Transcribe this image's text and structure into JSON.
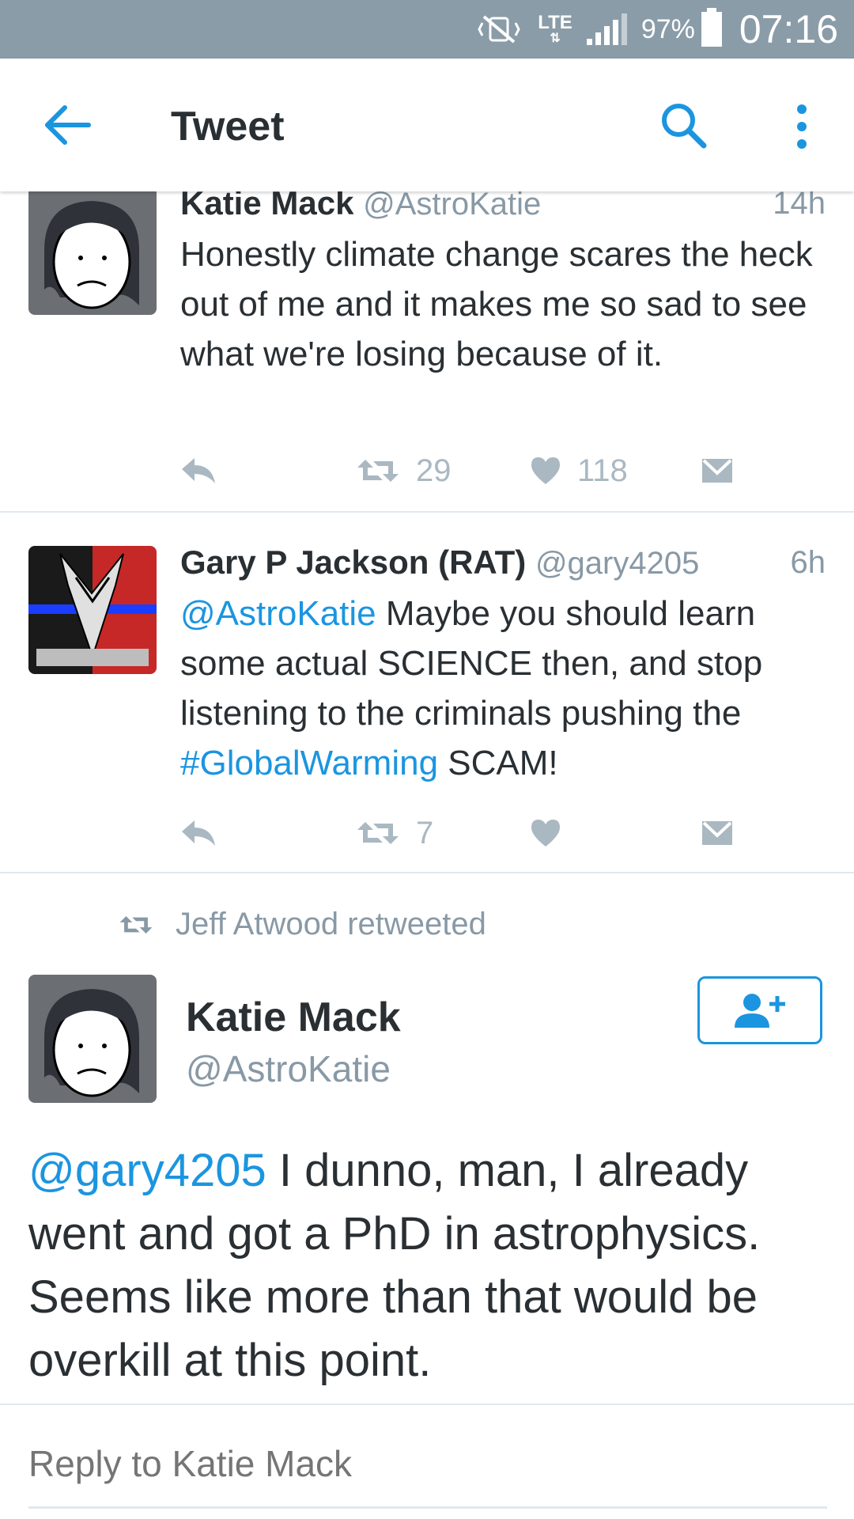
{
  "status_bar": {
    "network": "LTE",
    "battery": "97%",
    "time": "07:16"
  },
  "app_bar": {
    "title": "Tweet"
  },
  "tweets": [
    {
      "name": "Katie Mack",
      "handle": "@AstroKatie",
      "time": "14h",
      "text": "Honestly climate change scares the heck out of me and it makes me so sad to see what we're losing because of it.",
      "retweets": "29",
      "likes": "118"
    },
    {
      "name": "Gary P Jackson (RAT)",
      "handle": "@gary4205",
      "time": "6h",
      "mention": "@AstroKatie",
      "text_1": " Maybe you should learn some actual SCIENCE then, and stop listening to the criminals pushing the ",
      "hashtag": "#GlobalWarming",
      "text_2": " SCAM!",
      "retweets": "7",
      "likes": ""
    }
  ],
  "retweeted_by": "Jeff Atwood retweeted",
  "main_tweet": {
    "name": "Katie Mack",
    "handle": "@AstroKatie",
    "mention": "@gary4205",
    "text": " I dunno, man, I already went and got a PhD in astrophysics. Seems like more than that would be overkill at this point."
  },
  "reply": {
    "placeholder": "Reply to Katie Mack"
  },
  "colors": {
    "link": "#1b95e0",
    "muted": "#8899a6",
    "status_bar": "#8a9ca8"
  }
}
